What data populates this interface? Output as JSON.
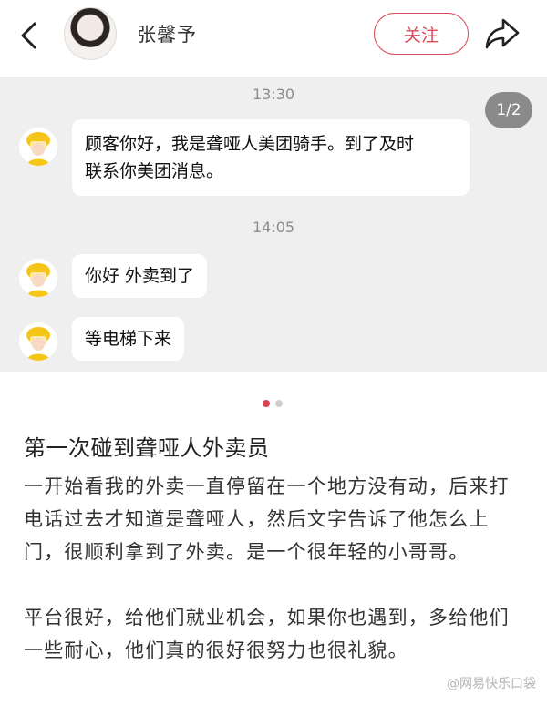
{
  "header": {
    "username": "张馨予",
    "follow_label": "关注"
  },
  "chat": {
    "pager": "1/2",
    "time1": "13:30",
    "time2": "14:05",
    "messages": [
      {
        "line1": "顾客你好，我是聋哑人美团骑手。到了及时",
        "line2": "联系你美团消息。"
      },
      {
        "text": "你好 外卖到了"
      },
      {
        "text": "等电梯下来"
      }
    ]
  },
  "carousel": {
    "active_index": 1,
    "total": 2
  },
  "post": {
    "title": "第一次碰到聋哑人外卖员",
    "para1": "一开始看我的外卖一直停留在一个地方没有动，后来打电话过去才知道是聋哑人，然后文字告诉了他怎么上门，很顺利拿到了外卖。是一个很年轻的小哥哥。",
    "para2": "平台很好，给他们就业机会，如果你也遇到，多给他们一些耐心，他们真的很好很努力也很礼貌。"
  },
  "watermark": "@网易快乐口袋",
  "colors": {
    "accent": "#d94a58",
    "chat_bg": "#efefef",
    "avatar_yellow": "#f5c518"
  },
  "icons": [
    "back-arrow-icon",
    "share-icon",
    "rider-avatar-icon"
  ]
}
